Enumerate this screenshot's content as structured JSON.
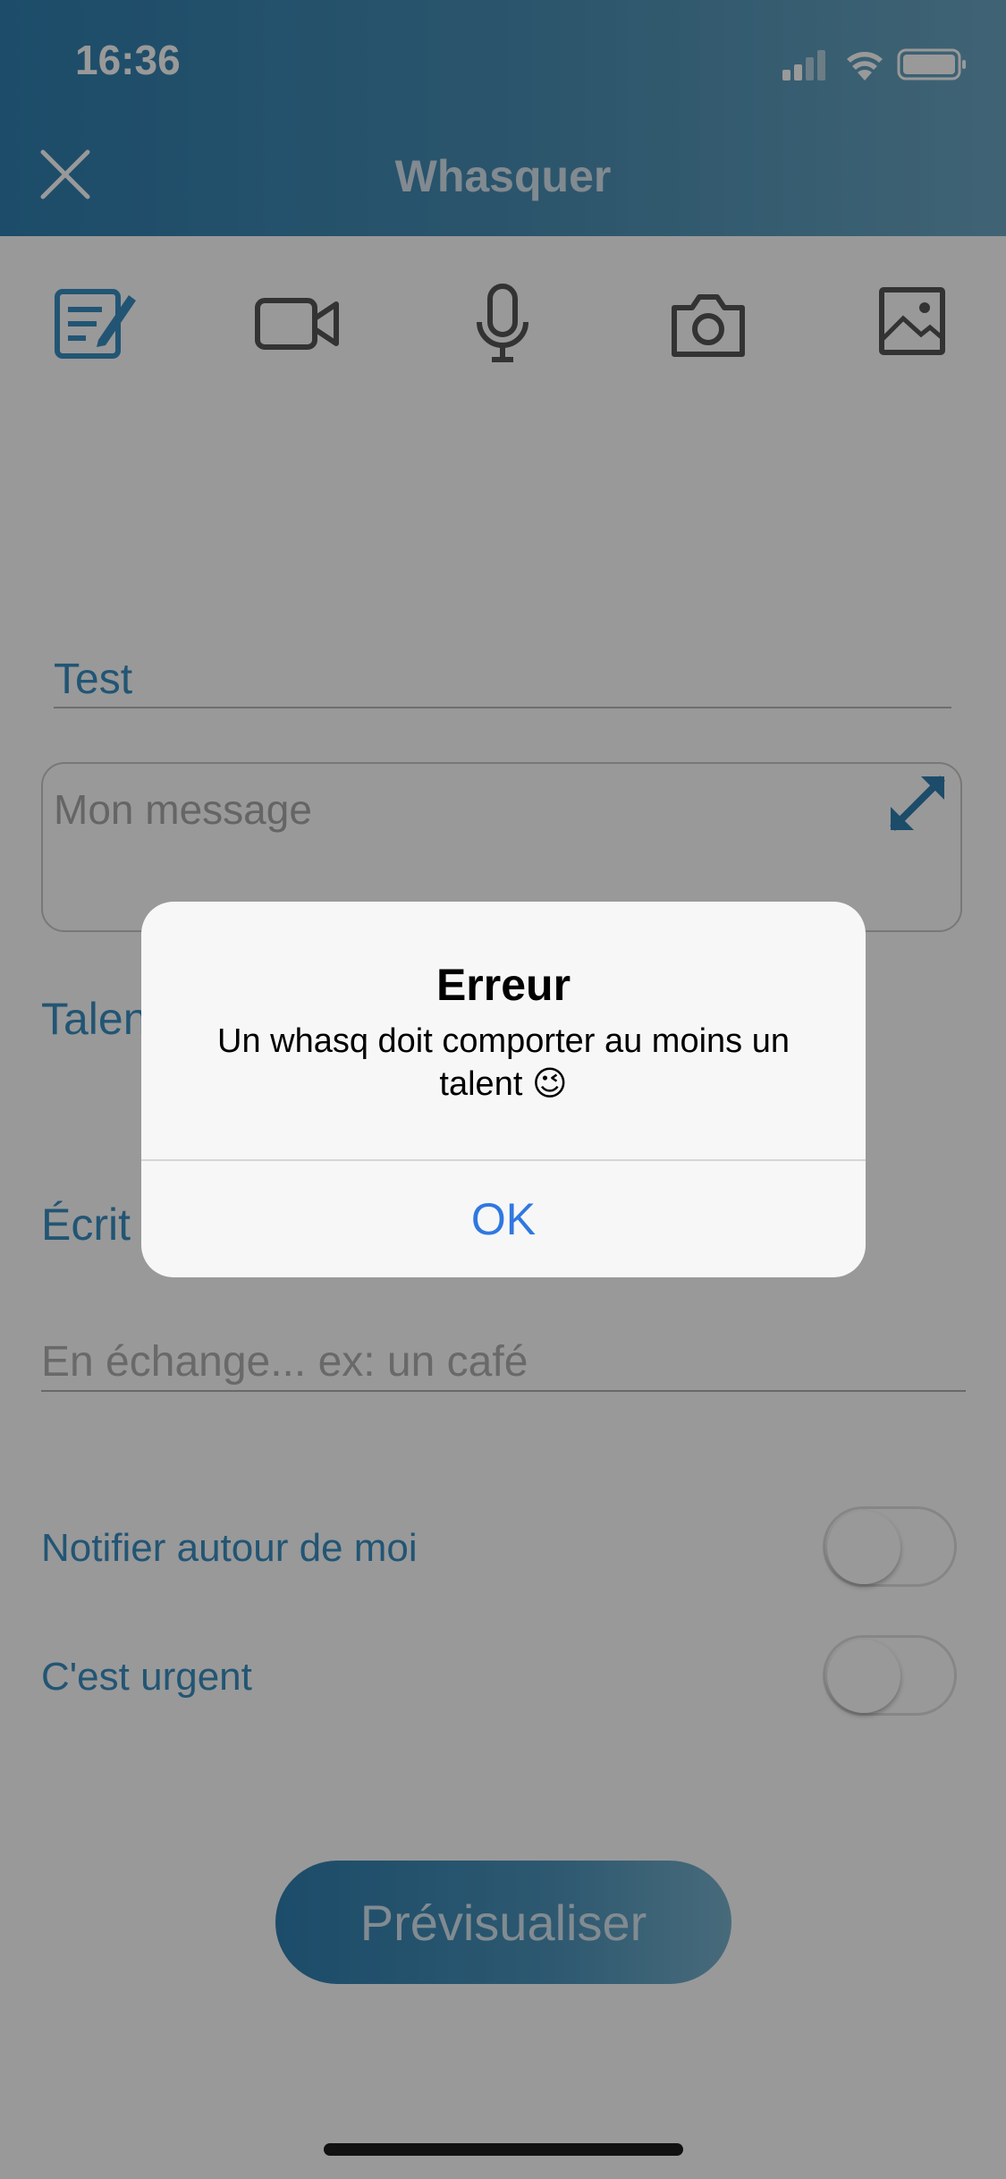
{
  "status_bar": {
    "time": "16:36"
  },
  "header": {
    "title": "Whasquer"
  },
  "toolbar": {
    "tools": [
      "text-edit",
      "video-camera",
      "microphone",
      "photo-camera",
      "image-gallery"
    ],
    "accent_color": "#3a8ec1"
  },
  "form": {
    "title_value": "Test",
    "message_placeholder": "Mon message",
    "talents_label_visible": "Talen",
    "written_label_visible": "Écrit",
    "exchange_placeholder": "En échange... ex: un café",
    "notify_label": "Notifier autour de moi",
    "notify_on": false,
    "urgent_label": "C'est urgent",
    "urgent_on": false,
    "preview_button": "Prévisualiser"
  },
  "alert": {
    "title": "Erreur",
    "message": "Un whasq doit comporter au moins un talent 😉",
    "ok_button": "OK"
  }
}
